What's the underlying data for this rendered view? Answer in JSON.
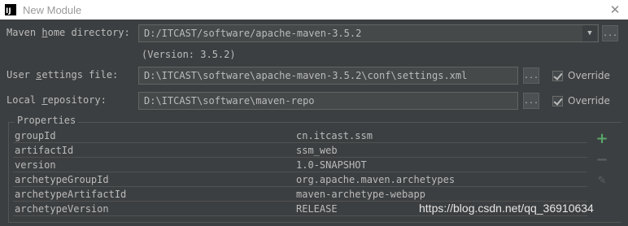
{
  "window": {
    "app_icon_text": "IJ",
    "title": "New Module",
    "close_glyph": "✕"
  },
  "maven_home": {
    "label_prefix": "Maven ",
    "label_mnemonic": "h",
    "label_suffix": "ome directory:",
    "value": "D:/ITCAST/software/apache-maven-3.5.2",
    "version_note": "(Version: 3.5.2)",
    "browse_label": "..."
  },
  "user_settings": {
    "label_prefix": "User ",
    "label_mnemonic": "s",
    "label_suffix": "ettings file:",
    "value": "D:\\ITCAST\\software\\apache-maven-3.5.2\\conf\\settings.xml",
    "browse_label": "...",
    "override_label": "Override",
    "override_checked": true
  },
  "local_repo": {
    "label_prefix": "Local ",
    "label_mnemonic": "r",
    "label_suffix": "epository:",
    "value": "D:\\ITCAST\\software\\maven-repo",
    "browse_label": "...",
    "override_label": "Override",
    "override_checked": true
  },
  "properties": {
    "title": "Properties",
    "rows": [
      {
        "key": "groupId",
        "value": "cn.itcast.ssm"
      },
      {
        "key": "artifactId",
        "value": "ssm_web"
      },
      {
        "key": "version",
        "value": "1.0-SNAPSHOT"
      },
      {
        "key": "archetypeGroupId",
        "value": "org.apache.maven.archetypes"
      },
      {
        "key": "archetypeArtifactId",
        "value": "maven-archetype-webapp"
      },
      {
        "key": "archetypeVersion",
        "value": "RELEASE"
      }
    ],
    "add_icon": "add-icon",
    "remove_icon": "remove-icon",
    "edit_icon": "edit-icon"
  },
  "watermark": "https://blog.csdn.net/qq_36910634",
  "colors": {
    "background": "#3c3f41",
    "field": "#45494a",
    "accent_add": "#59a869"
  }
}
